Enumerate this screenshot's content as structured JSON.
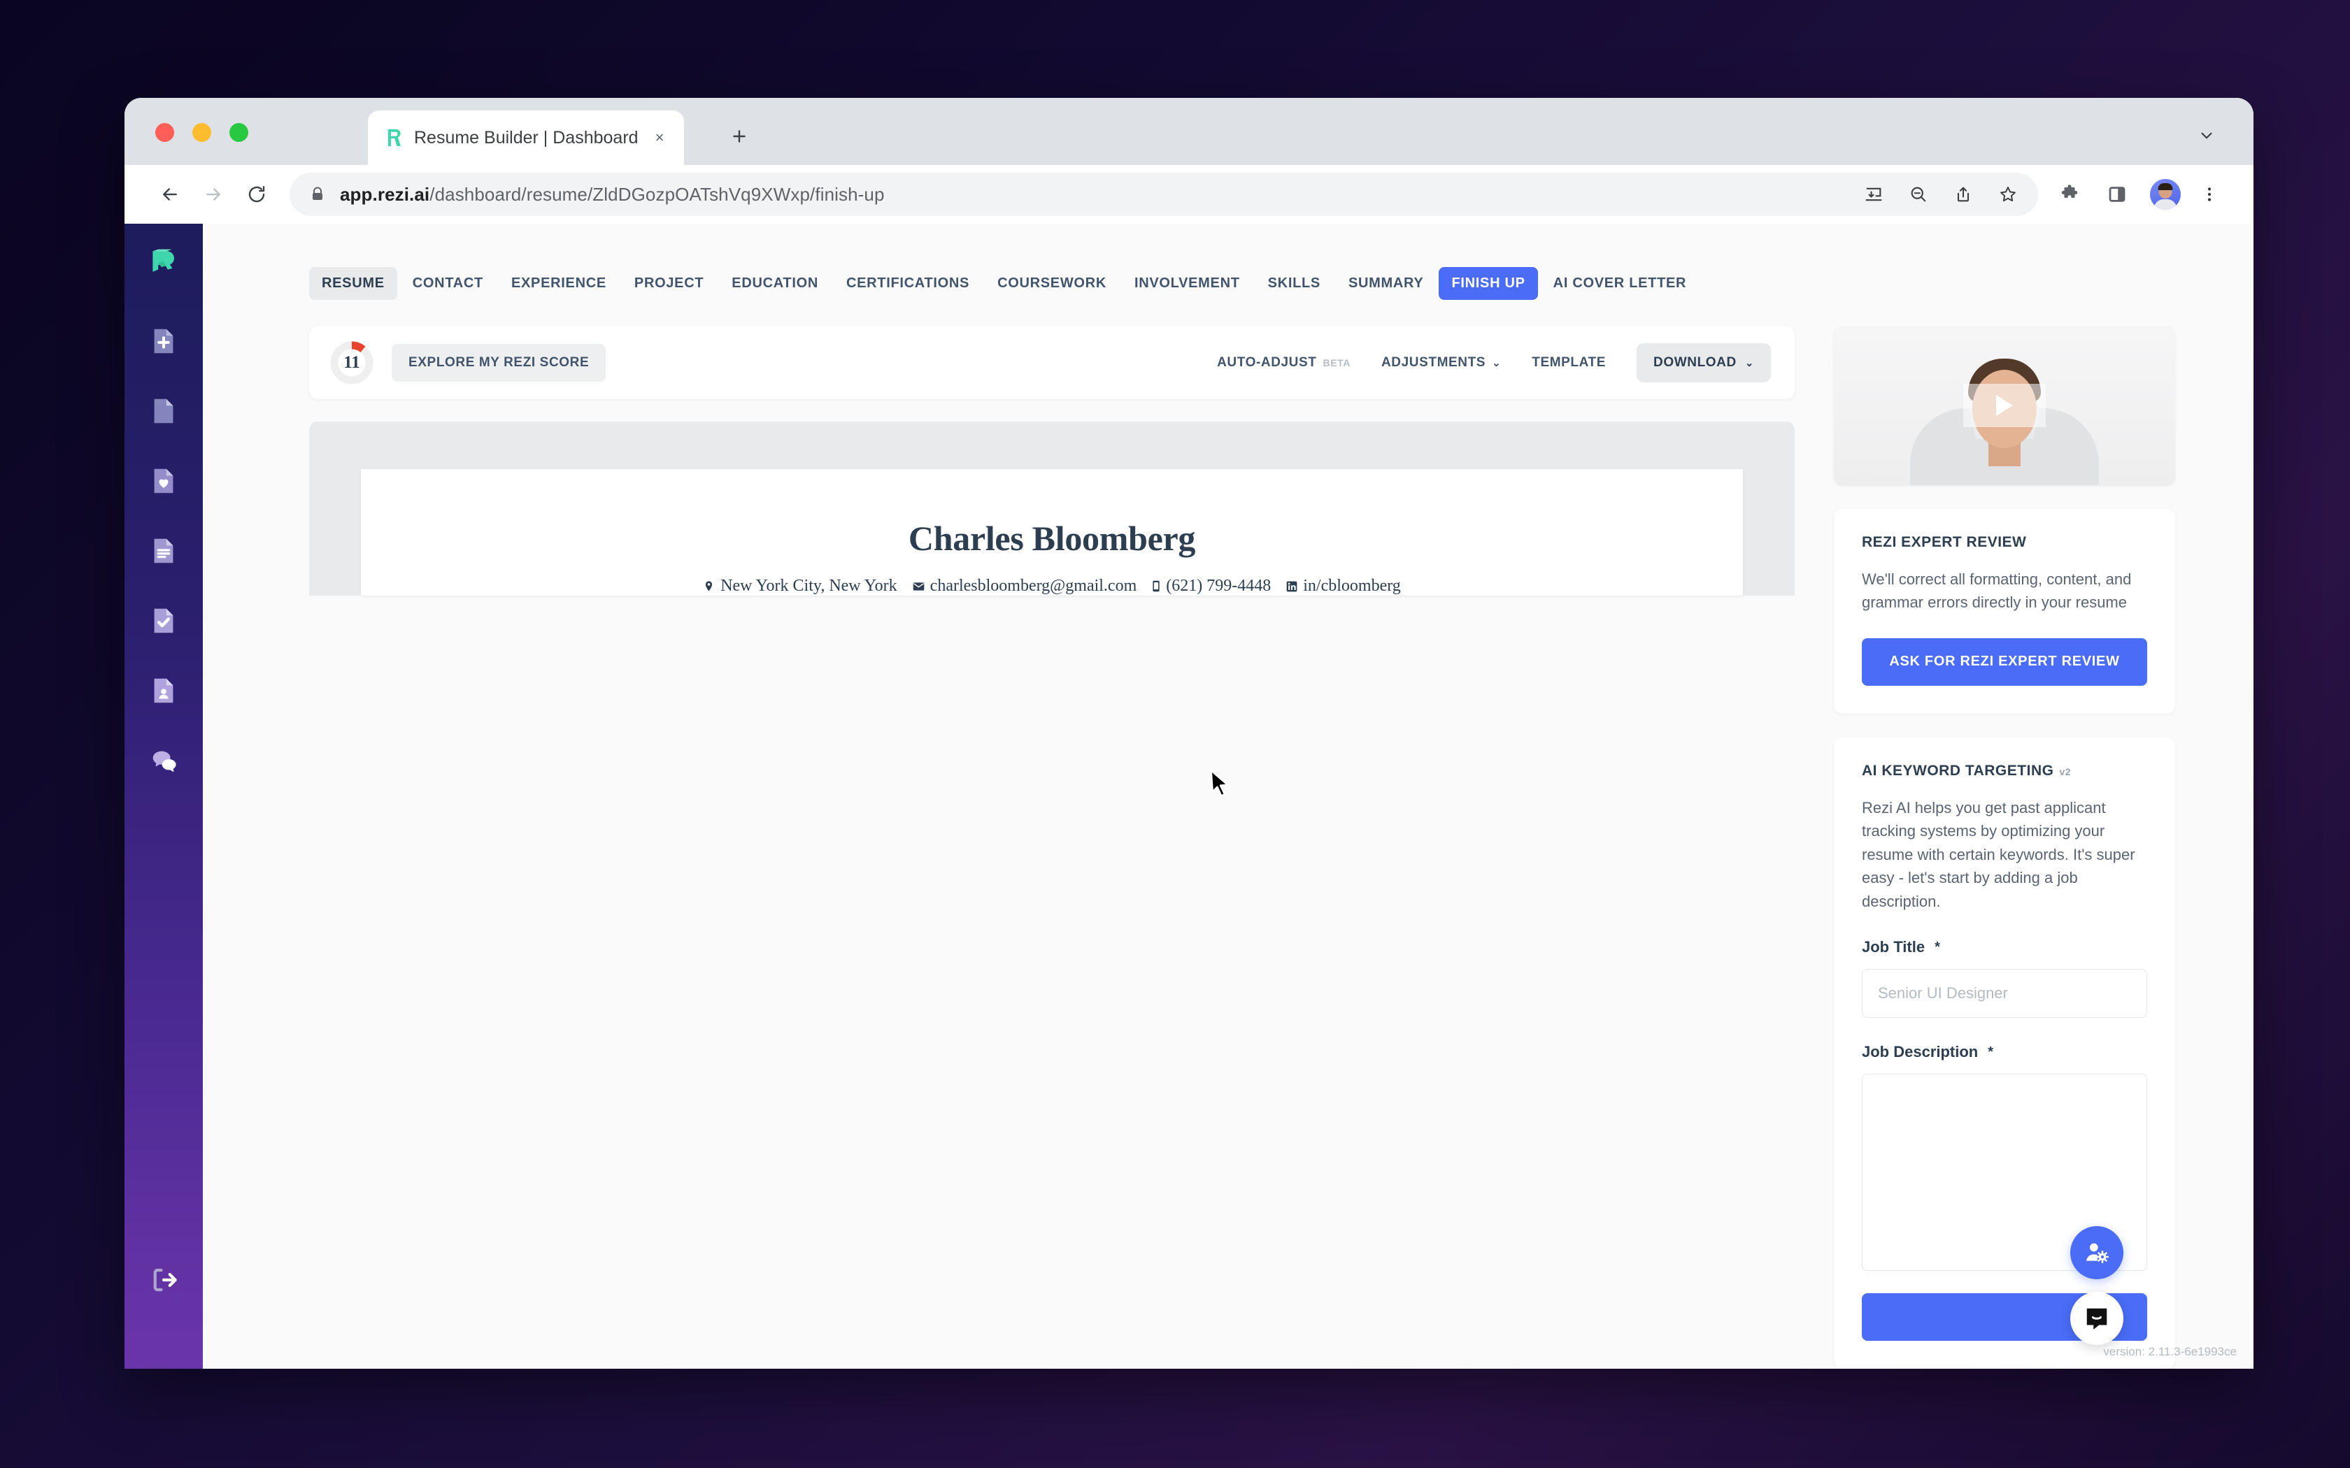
{
  "browser": {
    "tab": {
      "title": "Resume Builder | Dashboard",
      "favicon": "rezi-logo-icon",
      "close": "×"
    },
    "new_tab_label": "+",
    "url_host": "app.rezi.ai",
    "url_path": "/dashboard/resume/ZldDGozpOATshVq9XWxp/finish-up",
    "icons": {
      "back": "back-arrow-icon",
      "forward": "forward-arrow-icon",
      "reload": "reload-icon",
      "lock": "lock-icon",
      "install": "install-app-icon",
      "zoom_out": "zoom-out-icon",
      "share": "share-icon",
      "bookmark": "star-icon",
      "extensions": "puzzle-icon",
      "side_panel": "side-panel-icon",
      "profile": "profile-avatar-icon",
      "menu": "three-dot-menu-icon",
      "tab_list": "chevron-down-icon"
    }
  },
  "sidebar": {
    "logo": "rezi-logo",
    "items": [
      {
        "icon": "new-document-icon",
        "name": "create-resume"
      },
      {
        "icon": "document-icon",
        "name": "resumes"
      },
      {
        "icon": "document-heart-icon",
        "name": "favorites"
      },
      {
        "icon": "document-lines-icon",
        "name": "cover-letters"
      },
      {
        "icon": "document-check-icon",
        "name": "resume-review"
      },
      {
        "icon": "document-person-icon",
        "name": "profile-documents"
      },
      {
        "icon": "chat-bubbles-icon",
        "name": "messages"
      }
    ],
    "logout_icon": "logout-icon"
  },
  "nav_tabs": [
    {
      "label": "RESUME",
      "state": "current"
    },
    {
      "label": "CONTACT",
      "state": "default"
    },
    {
      "label": "EXPERIENCE",
      "state": "default"
    },
    {
      "label": "PROJECT",
      "state": "default"
    },
    {
      "label": "EDUCATION",
      "state": "default"
    },
    {
      "label": "CERTIFICATIONS",
      "state": "default"
    },
    {
      "label": "COURSEWORK",
      "state": "default"
    },
    {
      "label": "INVOLVEMENT",
      "state": "default"
    },
    {
      "label": "SKILLS",
      "state": "default"
    },
    {
      "label": "SUMMARY",
      "state": "default"
    },
    {
      "label": "FINISH UP",
      "state": "active"
    },
    {
      "label": "AI COVER LETTER",
      "state": "default"
    }
  ],
  "action_bar": {
    "score": "11",
    "score_percent": 11,
    "score_color": "#e8432c",
    "score_track_color": "#efefef",
    "explore_label": "EXPLORE MY REZI SCORE",
    "auto_adjust_label": "AUTO-ADJUST",
    "auto_adjust_badge": "BETA",
    "adjustments_label": "ADJUSTMENTS",
    "template_label": "TEMPLATE",
    "download_label": "DOWNLOAD",
    "chevron": "⌄"
  },
  "resume": {
    "name": "Charles Bloomberg",
    "contacts": [
      {
        "icon": "location-pin-icon",
        "text": "New York City, New York"
      },
      {
        "icon": "envelope-icon",
        "text": "charlesbloomberg@gmail.com"
      },
      {
        "icon": "phone-icon",
        "text": "(621) 799-4448"
      },
      {
        "icon": "linkedin-icon",
        "text": "in/cbloomberg"
      }
    ]
  },
  "side_panel": {
    "video": {
      "play_icon": "play-icon"
    },
    "expert_review": {
      "title": "REZI EXPERT REVIEW",
      "body": "We'll correct all formatting, content, and grammar errors directly in your resume",
      "button": "ASK FOR REZI EXPERT REVIEW"
    },
    "keyword_targeting": {
      "title": "AI KEYWORD TARGETING",
      "version_badge": "v2",
      "body": "Rezi AI helps you get past applicant tracking systems by optimizing your resume with certain keywords. It's super easy - let's start by adding a job description.",
      "job_title_label": "Job Title",
      "job_title_required": "*",
      "job_title_value": "",
      "job_title_placeholder": "Senior UI Designer",
      "job_description_label": "Job Description",
      "job_description_required": "*",
      "job_description_value": ""
    }
  },
  "floating": {
    "user_settings_icon": "user-gear-icon",
    "chat_icon": "intercom-chat-icon",
    "version": "version: 2.11.3-6e1993ce"
  },
  "colors": {
    "accent_blue": "#4a6cf7",
    "brand_teal": "#3fd6ab",
    "navy_text": "#2c3e50",
    "score_red": "#e8432c"
  }
}
